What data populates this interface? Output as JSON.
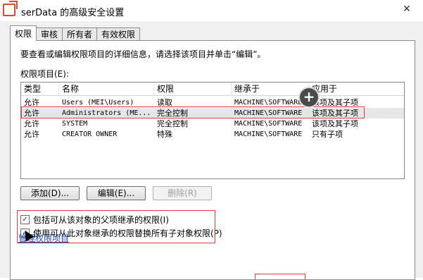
{
  "window": {
    "title": "serData 的高级安全设置",
    "close": "✕"
  },
  "tabs": [
    "权限",
    "审核",
    "所有者",
    "有效权限"
  ],
  "panel": {
    "instruction": "要查看或编辑权限项目的详细信息，请选择该项目并单击“编辑”。",
    "entries_label": "权限项目(E):"
  },
  "table": {
    "columns": [
      "类型",
      "名称",
      "权限",
      "继承于",
      "应用于"
    ],
    "rows": [
      [
        "允许",
        "Users (MEI\\Users)",
        "读取",
        "MACHINE\\SOFTWARE",
        "该项及其子项"
      ],
      [
        "允许",
        "Administrators (ME...",
        "完全控制",
        "MACHINE\\SOFTWARE",
        "该项及其子项"
      ],
      [
        "允许",
        "SYSTEM",
        "完全控制",
        "MACHINE\\SOFTWARE",
        "该项及其子项"
      ],
      [
        "允许",
        "CREATOR OWNER",
        "特殊",
        "MACHINE\\SOFTWARE",
        "只有子项"
      ]
    ]
  },
  "buttons": {
    "add": "添加(D)...",
    "edit": "编辑(E)...",
    "remove": "删除(R)"
  },
  "checkboxes": {
    "inherit": "包括可从该对象的父项继承的权限(I)",
    "replace": "使用可从此对象继承的权限替换所有子对象权限(P)"
  },
  "link": "管理权限项目",
  "colors": {
    "highlight_border": "#e03a3a",
    "link": "#1f4fb4"
  }
}
